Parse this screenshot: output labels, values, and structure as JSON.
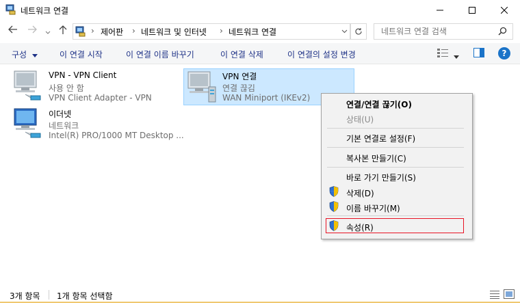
{
  "window": {
    "title": "네트워크 연결",
    "minimize_icon": "minimize-icon",
    "maximize_icon": "maximize-icon",
    "close_icon": "close-icon"
  },
  "nav": {
    "breadcrumb": [
      "제어판",
      "네트워크 및 인터넷",
      "네트워크 연결"
    ],
    "search_placeholder": "네트워크 연결 검색"
  },
  "toolbar": {
    "organize": "구성",
    "start_connection": "이 연결 시작",
    "rename": "이 연결 이름 바꾸기",
    "delete": "이 연결 삭제",
    "change_settings": "이 연결의 설정 변경"
  },
  "items": [
    {
      "name": "VPN - VPN Client",
      "status": "사용 안 함",
      "device": "VPN Client Adapter - VPN"
    },
    {
      "name": "VPN 연결",
      "status": "연결 끊김",
      "device": "WAN Miniport (IKEv2)"
    },
    {
      "name": "이더넷",
      "status": "네트워크",
      "device": "Intel(R) PRO/1000 MT Desktop ..."
    }
  ],
  "context_menu": {
    "connect_disconnect": "연결/연결 끊기(O)",
    "status": "상태(U)",
    "set_default": "기본 연결로 설정(F)",
    "create_copy": "복사본 만들기(C)",
    "create_shortcut": "바로 가기 만들기(S)",
    "delete": "삭제(D)",
    "rename": "이름 바꾸기(M)",
    "properties": "속성(R)"
  },
  "statusbar": {
    "item_count": "3개 항목",
    "selected": "1개 항목 선택함"
  },
  "colors": {
    "selection_bg": "#cce8ff",
    "selection_border": "#99d1ff",
    "link": "#1e3287",
    "highlight_border": "#e81123",
    "help": "#1a73c8"
  }
}
